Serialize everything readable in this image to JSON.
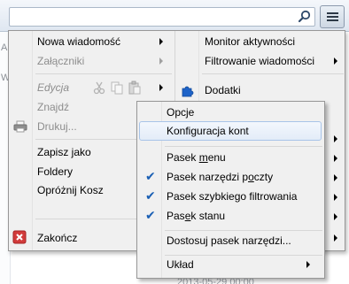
{
  "background": {
    "left_letters": [
      "A",
      "W"
    ],
    "bottom_text": "2013-05-29 00:00"
  },
  "main_menu": {
    "left": [
      {
        "label": "Nowa wiadomość",
        "has_submenu": true,
        "disabled": false
      },
      {
        "label": "Załączniki",
        "has_submenu": true,
        "disabled": true
      },
      {
        "label": "Edycja",
        "has_submenu": true,
        "disabled": true,
        "italic": true
      },
      {
        "label": "Znajdź",
        "has_submenu": false,
        "disabled": true
      },
      {
        "label": "Drukuj...",
        "has_submenu": false,
        "disabled": true
      },
      {
        "label": "Zapisz jako",
        "has_submenu": true,
        "disabled": false
      },
      {
        "label": "Foldery",
        "has_submenu": false,
        "disabled": false
      },
      {
        "label": "Opróżnij Kosz",
        "has_submenu": false,
        "disabled": false
      },
      {
        "label": "Zakończ",
        "has_submenu": false,
        "disabled": false
      }
    ],
    "right": [
      {
        "label": "Monitor aktywności",
        "has_submenu": false
      },
      {
        "label": "Filtrowanie wiadomości",
        "has_submenu": true
      },
      {
        "label": "Dodatki",
        "has_submenu": false
      }
    ]
  },
  "submenu": {
    "items": [
      {
        "label": "Opcje",
        "checked": false,
        "has_submenu": false
      },
      {
        "label": "Konfiguracja kont",
        "checked": false,
        "has_submenu": false,
        "highlighted": true
      },
      {
        "label_pre": "Pasek ",
        "label_u": "m",
        "label_post": "enu",
        "checked": false,
        "has_submenu": false
      },
      {
        "label_pre": "Pasek narzędzi p",
        "label_u": "o",
        "label_post": "czty",
        "checked": true,
        "has_submenu": false
      },
      {
        "label": "Pasek szybkiego filtrowania",
        "checked": true,
        "has_submenu": false
      },
      {
        "label_pre": "Pas",
        "label_u": "e",
        "label_post": "k stanu",
        "checked": true,
        "has_submenu": false
      },
      {
        "label": "Dostosuj pasek narzędzi...",
        "checked": false,
        "has_submenu": false
      },
      {
        "label": "Układ",
        "checked": false,
        "has_submenu": true
      }
    ]
  },
  "colors": {
    "check": "#1a5fb4",
    "highlight_border": "#a8c4e8",
    "menu_bg": "#f0f0f0",
    "quit_icon": "#d23b3b",
    "addons_icon": "#1e63c8"
  }
}
